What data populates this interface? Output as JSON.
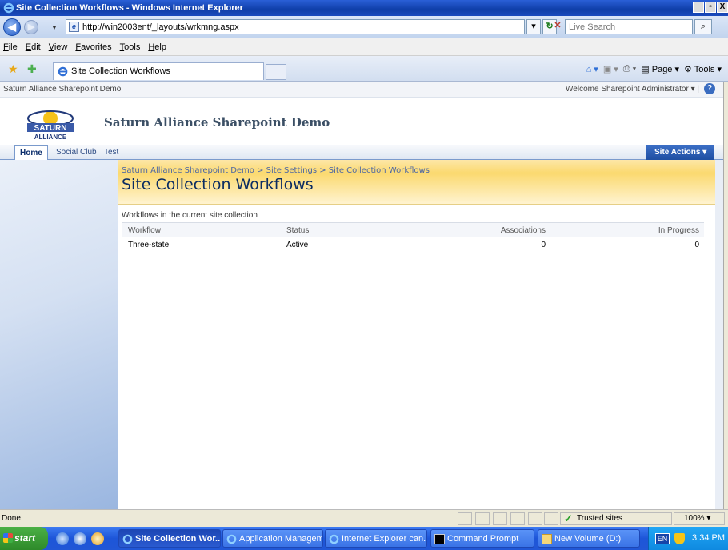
{
  "window": {
    "title": "Site Collection Workflows - Windows Internet Explorer",
    "controls": [
      "_",
      "▫",
      "X"
    ]
  },
  "address": {
    "url": "http://win2003ent/_layouts/wrkmng.aspx",
    "search_placeholder": "Live Search"
  },
  "menu": [
    "File",
    "Edit",
    "View",
    "Favorites",
    "Tools",
    "Help"
  ],
  "tab": {
    "label": "Site Collection Workflows"
  },
  "commandbar": {
    "page": "Page",
    "tools": "Tools"
  },
  "sp": {
    "site_name": "Saturn Alliance Sharepoint Demo",
    "welcome": "Welcome Sharepoint Administrator ▾ |",
    "help": "?",
    "logo_text": "SATURN",
    "logo_sub": "ALLIANCE",
    "title": "Saturn Alliance Sharepoint Demo",
    "nav": [
      "Home",
      "Social Club",
      "Test"
    ],
    "site_actions": "Site Actions ▾"
  },
  "main": {
    "breadcrumb": "Saturn Alliance Sharepoint Demo > Site Settings > Site Collection Workflows",
    "page_title": "Site Collection Workflows",
    "description": "Workflows in the current site collection",
    "columns": [
      "Workflow",
      "Status",
      "Associations",
      "In Progress"
    ],
    "rows": [
      {
        "workflow": "Three-state",
        "status": "Active",
        "associations": "0",
        "in_progress": "0"
      }
    ]
  },
  "status": {
    "text": "Done",
    "zone": "Trusted sites",
    "zoom": "100%"
  },
  "taskbar": {
    "start": "start",
    "buttons": [
      {
        "label": "Site Collection Wor..."
      },
      {
        "label": "Application Managem..."
      },
      {
        "label": "Internet Explorer can..."
      },
      {
        "label": "Command Prompt"
      },
      {
        "label": "New Volume (D:)"
      }
    ],
    "lang": "EN",
    "clock": "3:34 PM"
  }
}
